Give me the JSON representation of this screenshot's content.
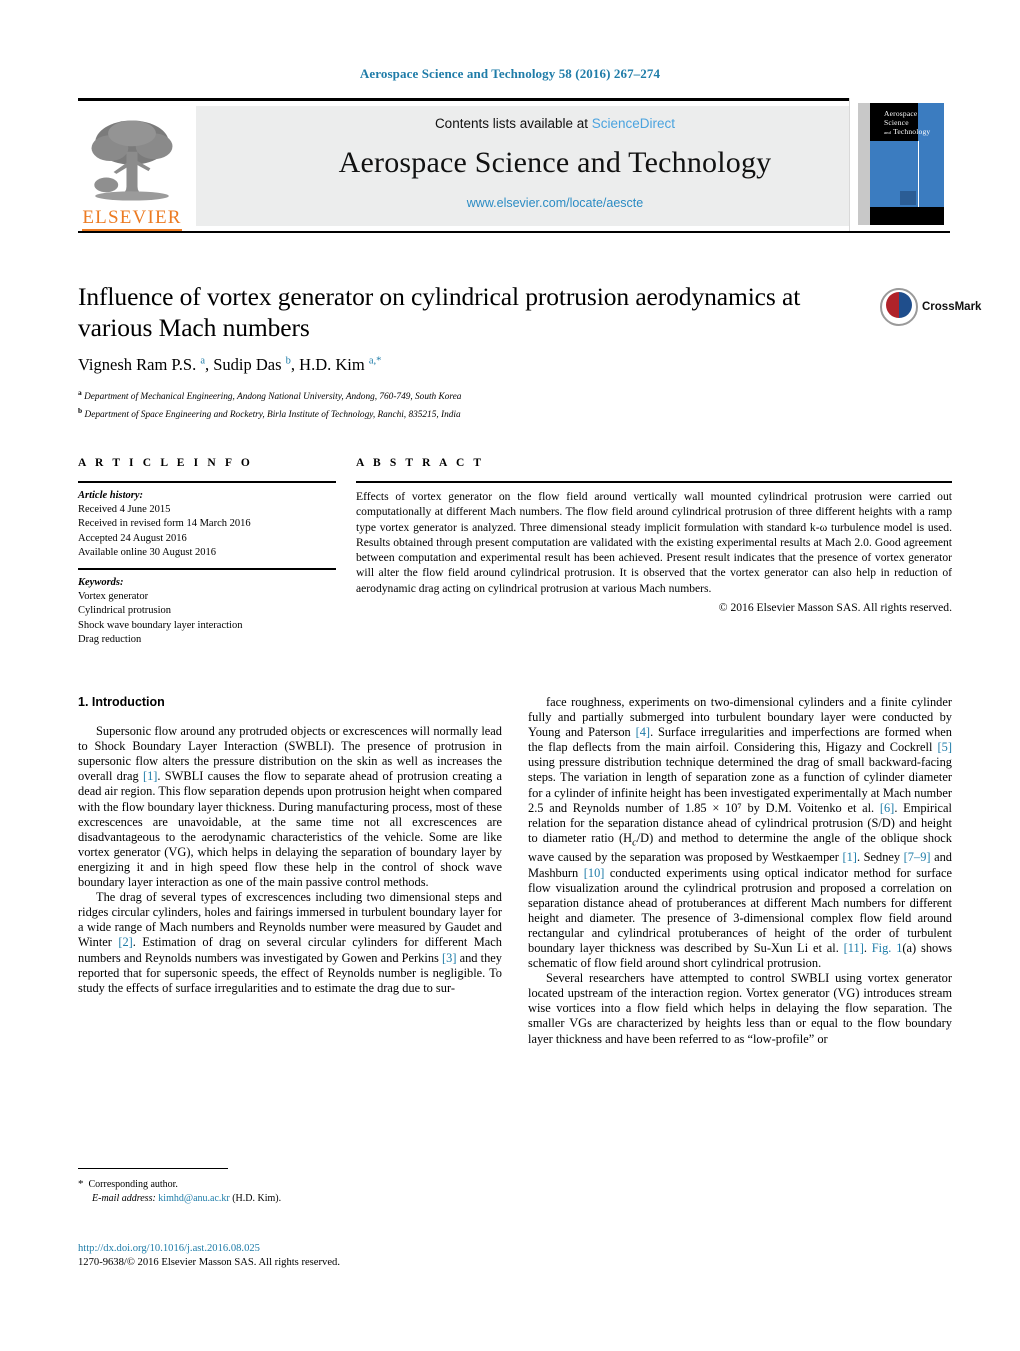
{
  "running_head": "Aerospace Science and Technology 58 (2016) 267–274",
  "masthead": {
    "contents_prefix": "Contents lists available at ",
    "sciencedirect": "ScienceDirect",
    "journal_title": "Aerospace Science and Technology",
    "journal_url": "www.elsevier.com/locate/aescte",
    "publisher_logo_text": "ELSEVIER",
    "cover_title_line1": "Aerospace",
    "cover_title_line2": "Science",
    "cover_title_and": "and",
    "cover_title_line3": "Technology"
  },
  "article": {
    "title": "Influence of vortex generator on cylindrical protrusion aerodynamics at various Mach numbers",
    "authors_html": "Vignesh Ram P.S. <sup>a</sup>, Sudip Das <sup>b</sup>, H.D. Kim <sup>a,*</sup>",
    "affiliation_a": "Department of Mechanical Engineering, Andong National University, Andong, 760-749, South Korea",
    "affiliation_b": "Department of Space Engineering and Rocketry, Birla Institute of Technology, Ranchi, 835215, India",
    "crossmark_label": "CrossMark"
  },
  "article_info": {
    "heading": "A R T I C L E  I N F O",
    "history_label": "Article history:",
    "history": [
      "Received 4 June 2015",
      "Received in revised form 14 March 2016",
      "Accepted 24 August 2016",
      "Available online 30 August 2016"
    ],
    "keywords_label": "Keywords:",
    "keywords": [
      "Vortex generator",
      "Cylindrical protrusion",
      "Shock wave boundary layer interaction",
      "Drag reduction"
    ]
  },
  "abstract": {
    "heading": "A B S T R A C T",
    "text": "Effects of vortex generator on the flow field around vertically wall mounted cylindrical protrusion were carried out computationally at different Mach numbers. The flow field around cylindrical protrusion of three different heights with a ramp type vortex generator is analyzed. Three dimensional steady implicit formulation with standard k-ω turbulence model is used. Results obtained through present computation are validated with the existing experimental results at Mach 2.0. Good agreement between computation and experimental result has been achieved. Present result indicates that the presence of vortex generator will alter the flow field around cylindrical protrusion. It is observed that the vortex generator can also help in reduction of aerodynamic drag acting on cylindrical protrusion at various Mach numbers.",
    "copyright": "© 2016 Elsevier Masson SAS. All rights reserved."
  },
  "body": {
    "section_heading": "1. Introduction",
    "left_paragraphs": [
      "Supersonic flow around any protruded objects or excrescences will normally lead to Shock Boundary Layer Interaction (SWBLI). The presence of protrusion in supersonic flow alters the pressure distribution on the skin as well as increases the overall drag [1]. SWBLI causes the flow to separate ahead of protrusion creating a dead air region. This flow separation depends upon protrusion height when compared with the flow boundary layer thickness. During manufacturing process, most of these excrescences are unavoidable, at the same time not all excrescences are disadvantageous to the aerodynamic characteristics of the vehicle. Some are like vortex generator (VG), which helps in delaying the separation of boundary layer by energizing it and in high speed flow these help in the control of shock wave boundary layer interaction as one of the main passive control methods.",
      "The drag of several types of excrescences including two dimensional steps and ridges circular cylinders, holes and fairings immersed in turbulent boundary layer for a wide range of Mach numbers and Reynolds number were measured by Gaudet and Winter [2]. Estimation of drag on several circular cylinders for different Mach numbers and Reynolds numbers was investigated by Gowen and Perkins [3] and they reported that for supersonic speeds, the effect of Reynolds number is negligible. To study the effects of surface irregularities and to estimate the drag due to sur-"
    ],
    "right_paragraphs": [
      "face roughness, experiments on two-dimensional cylinders and a finite cylinder fully and partially submerged into turbulent boundary layer were conducted by Young and Paterson [4]. Surface irregularities and imperfections are formed when the flap deflects from the main airfoil. Considering this, Higazy and Cockrell [5] using pressure distribution technique determined the drag of small backward-facing steps. The variation in length of separation zone as a function of cylinder diameter for a cylinder of infinite height has been investigated experimentally at Mach number 2.5 and Reynolds number of 1.85 × 10⁷ by D.M. Voitenko et al. [6]. Empirical relation for the separation distance ahead of cylindrical protrusion (S/D) and height to diameter ratio (Hc/D) and method to determine the angle of the oblique shock wave caused by the separation was proposed by Westkaemper [1]. Sedney [7–9] and Mashburn [10] conducted experiments using optical indicator method for surface flow visualization around the cylindrical protrusion and proposed a correlation on separation distance ahead of protuberances at different Mach numbers for different height and diameter. The presence of 3-dimensional complex flow field around rectangular and cylindrical protuberances of height of the order of turbulent boundary layer thickness was described by Su-Xun Li et al. [11]. Fig. 1(a) shows schematic of flow field around short cylindrical protrusion.",
      "Several researchers have attempted to control SWBLI using vortex generator located upstream of the interaction region. Vortex generator (VG) introduces stream wise vortices into a flow field which helps in delaying the flow separation. The smaller VGs are characterized by heights less than or equal to the flow boundary layer thickness and have been referred to as “low-profile” or"
    ]
  },
  "footnote": {
    "corresponding_author": "Corresponding author.",
    "email_label": "E-mail address:",
    "email": "kimhd@anu.ac.kr",
    "email_owner": "(H.D. Kim)."
  },
  "footer": {
    "doi": "http://dx.doi.org/10.1016/j.ast.2016.08.025",
    "issn_line": "1270-9638/© 2016 Elsevier Masson SAS. All rights reserved."
  },
  "colors": {
    "link": "#1f7ca8",
    "sciencedirect": "#4aa3df",
    "elsevier_orange": "#ec7b22",
    "banner_grey": "#eceded",
    "cover_blue": "#3b7cc0"
  }
}
